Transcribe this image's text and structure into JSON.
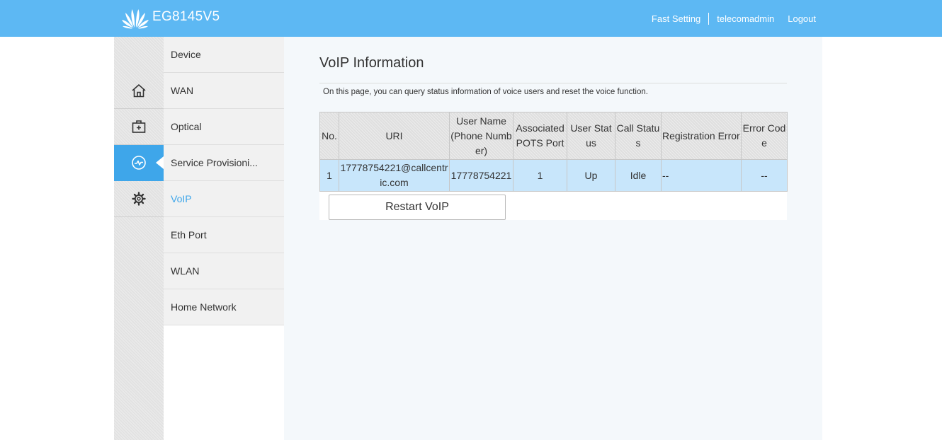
{
  "header": {
    "product": "EG8145V5",
    "links": {
      "fast_setting": "Fast Setting",
      "user": "telecomadmin",
      "logout": "Logout"
    },
    "color": "#5db8f3"
  },
  "sidebar_icons": [
    {
      "name": "home-icon",
      "active": false
    },
    {
      "name": "medical-kit-icon",
      "active": false
    },
    {
      "name": "status-pulse-icon",
      "active": true
    },
    {
      "name": "gear-icon",
      "active": false
    }
  ],
  "menu": {
    "items": [
      {
        "label": "Device"
      },
      {
        "label": "WAN"
      },
      {
        "label": "Optical"
      },
      {
        "label": "Service Provisioni..."
      },
      {
        "label": "VoIP",
        "selected": true
      },
      {
        "label": "Eth Port"
      },
      {
        "label": "WLAN"
      },
      {
        "label": "Home Network"
      }
    ]
  },
  "page": {
    "title": "VoIP Information",
    "description": "On this page, you can query status information of voice users and reset the voice function.",
    "table": {
      "headers": {
        "no": "No.",
        "uri": "URI",
        "user_name": "User Name (Phone Number)",
        "pots": "Associated POTS Port",
        "user_status": "User Status",
        "call_status": "Call Status",
        "reg_err": "Registration Error",
        "err_code": "Error Code"
      },
      "rows": [
        {
          "no": "1",
          "uri": "17778754221@callcentric.com",
          "user_name": "17778754221",
          "pots": "1",
          "user_status": "Up",
          "call_status": "Idle",
          "reg_err": "--",
          "err_code": "--"
        }
      ]
    },
    "restart_label": "Restart VoIP"
  }
}
